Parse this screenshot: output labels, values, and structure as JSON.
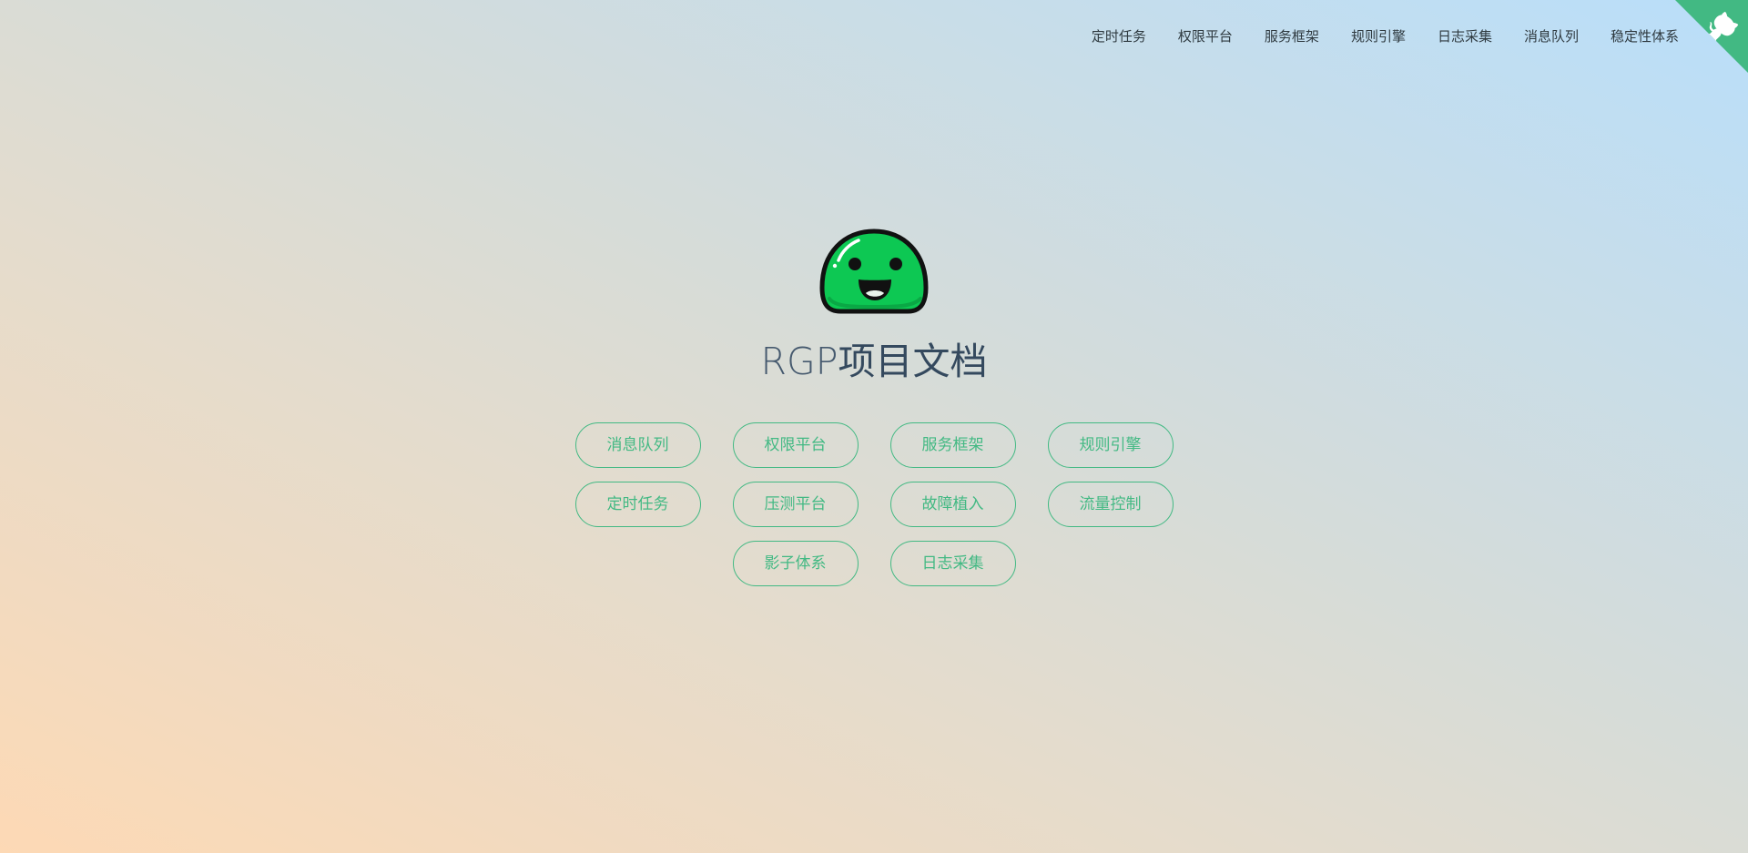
{
  "nav": {
    "items": [
      "定时任务",
      "权限平台",
      "服务框架",
      "规则引擎",
      "日志采集",
      "消息队列",
      "稳定性体系"
    ]
  },
  "corner": {
    "icon": "github-cat-icon",
    "color": "#42b983"
  },
  "cover": {
    "title_latin": "RGP",
    "title_cjk": "项目文档",
    "logo_icon": "green-slime-mascot-icon",
    "buttons": [
      [
        "消息队列",
        "权限平台",
        "服务框架",
        "规则引擎"
      ],
      [
        "定时任务",
        "压测平台",
        "故障植入",
        "流量控制"
      ],
      [
        "影子体系",
        "日志采集"
      ]
    ]
  },
  "colors": {
    "accent": "#42b983",
    "title": "#34495e",
    "gradient_start": "#fdd9b5",
    "gradient_end": "#b9defa"
  }
}
